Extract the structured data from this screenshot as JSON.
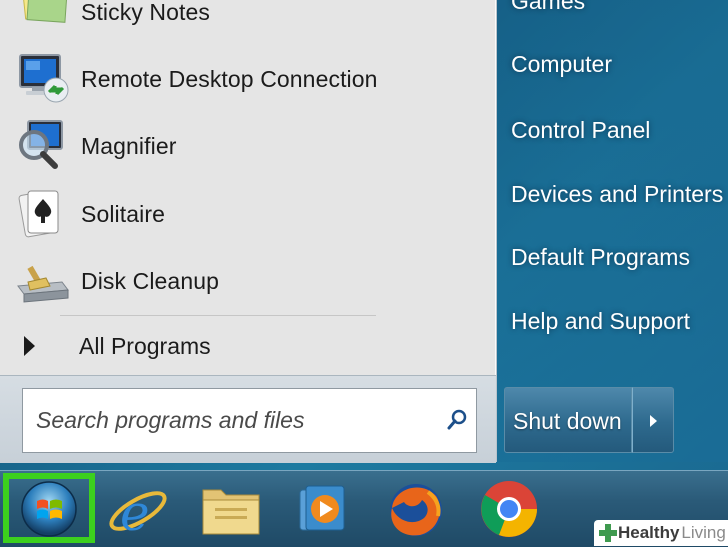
{
  "start_menu": {
    "programs": [
      {
        "label": "Sticky Notes",
        "icon": "sticky-notes-icon"
      },
      {
        "label": "Remote Desktop Connection",
        "icon": "remote-desktop-icon"
      },
      {
        "label": "Magnifier",
        "icon": "magnifier-icon"
      },
      {
        "label": "Solitaire",
        "icon": "solitaire-icon"
      },
      {
        "label": "Disk Cleanup",
        "icon": "disk-cleanup-icon"
      }
    ],
    "all_programs_label": "All Programs",
    "search_placeholder": "Search programs and files",
    "right_links": [
      "Games",
      "Computer",
      "Control Panel",
      "Devices and Printers",
      "Default Programs",
      "Help and Support"
    ],
    "shutdown_label": "Shut down"
  },
  "taskbar": {
    "items": [
      {
        "icon": "windows-start-orb-icon"
      },
      {
        "icon": "internet-explorer-icon"
      },
      {
        "icon": "windows-explorer-icon"
      },
      {
        "icon": "windows-media-player-icon"
      },
      {
        "icon": "firefox-icon"
      },
      {
        "icon": "chrome-icon"
      }
    ]
  },
  "watermark": {
    "bold": "Healthy",
    "light": "Living"
  },
  "colors": {
    "highlight": "#3cd01e",
    "menu_bg": "#e5e5e5",
    "taskbar": "#2a5a78"
  }
}
